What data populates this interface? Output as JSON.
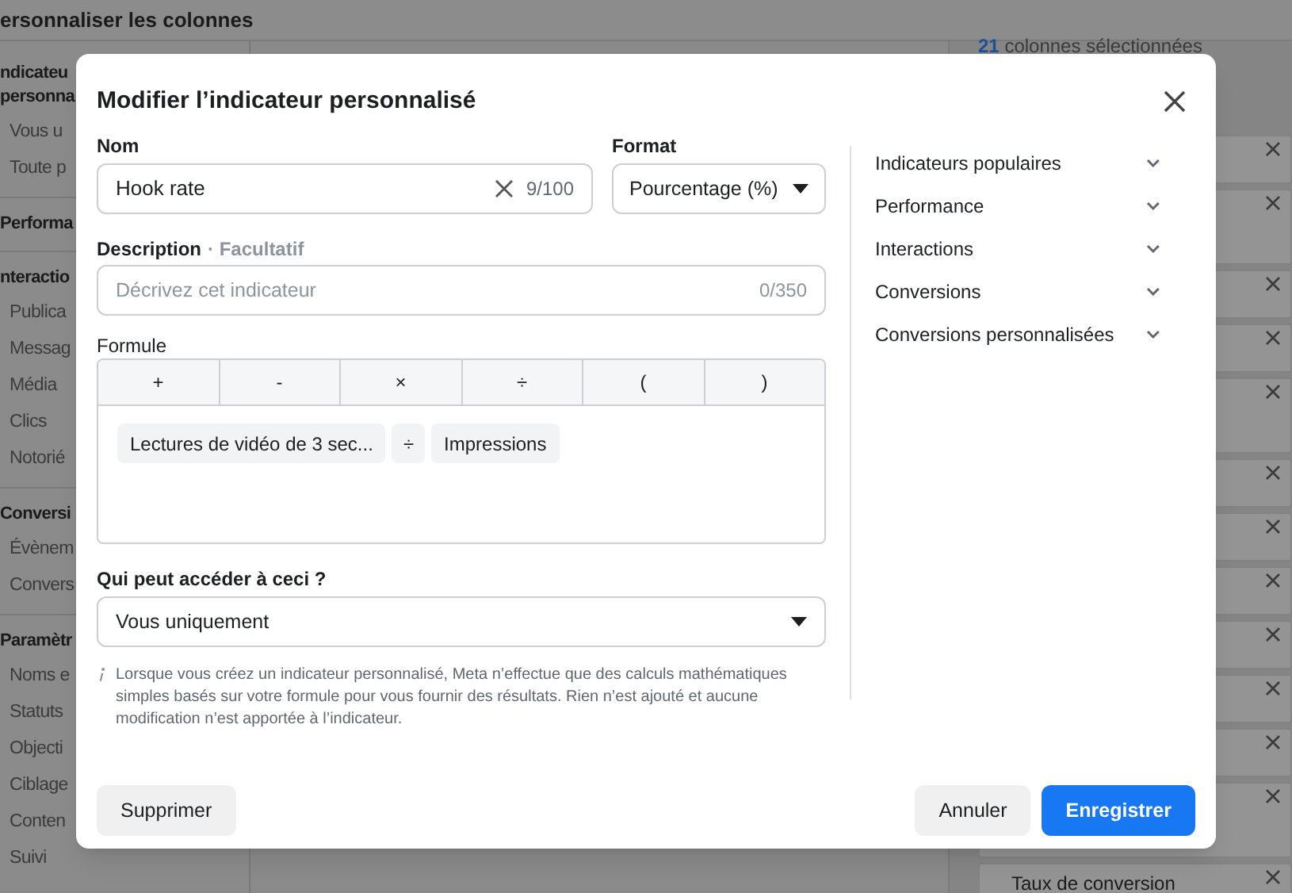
{
  "page_title": "ersonnaliser les colonnes",
  "sidebar": [
    {
      "heading": "ndicateu personna",
      "items": [
        "Vous u",
        "Toute p"
      ]
    },
    {
      "heading": "Performa"
    },
    {
      "heading": "nteractio",
      "items": [
        "Publica",
        "Messag",
        "Média",
        "Clics",
        "Notorié"
      ]
    },
    {
      "heading": "Conversi",
      "items": [
        "Évènem",
        "Convers"
      ]
    },
    {
      "heading": "Paramètr",
      "items": [
        "Noms e",
        "Statuts",
        "Objecti",
        "Ciblage",
        "Conten",
        "Suivi"
      ]
    }
  ],
  "selected_panel": {
    "count": "21",
    "label": "colonnes sélectionnées",
    "items": [
      {
        "removable": true
      },
      {
        "removable": true,
        "tall": true
      },
      {
        "removable": true
      },
      {
        "removable": true
      },
      {
        "removable": true,
        "tall": true
      },
      {
        "removable": true
      },
      {
        "removable": true
      },
      {
        "removable": true
      },
      {
        "removable": true
      },
      {
        "removable": true
      },
      {
        "removable": true
      },
      {
        "removable": true,
        "tall": true
      },
      {
        "label": "Taux de conversion",
        "removable": true
      }
    ]
  },
  "dialog": {
    "title": "Modifier l’indicateur personnalisé",
    "name_label": "Nom",
    "name_value": "Hook rate",
    "name_counter": "9/100",
    "format_label": "Format",
    "format_value": "Pourcentage (%)",
    "description_label": "Description",
    "description_optional": "· Facultatif",
    "description_placeholder": "Décrivez cet indicateur",
    "description_counter": "0/350",
    "formula_label": "Formule",
    "operators": [
      "+",
      "-",
      "×",
      "÷",
      "(",
      ")"
    ],
    "formula_tokens": [
      {
        "kind": "metric",
        "text": "Lectures de vidéo de 3 sec..."
      },
      {
        "kind": "operator",
        "text": "÷"
      },
      {
        "kind": "metric",
        "text": "Impressions"
      }
    ],
    "access_label": "Qui peut accéder à ceci ?",
    "access_value": "Vous uniquement",
    "info_text": "Lorsque vous créez un indicateur personnalisé, Meta n’effectue que des calculs mathématiques simples basés sur votre formule pour vous fournir des résultats. Rien n’est ajouté et aucune modification n’est apportée à l’indicateur.",
    "categories": [
      "Indicateurs populaires",
      "Performance",
      "Interactions",
      "Conversions",
      "Conversions personnalisées"
    ],
    "buttons": {
      "delete": "Supprimer",
      "cancel": "Annuler",
      "save": "Enregistrer"
    }
  }
}
